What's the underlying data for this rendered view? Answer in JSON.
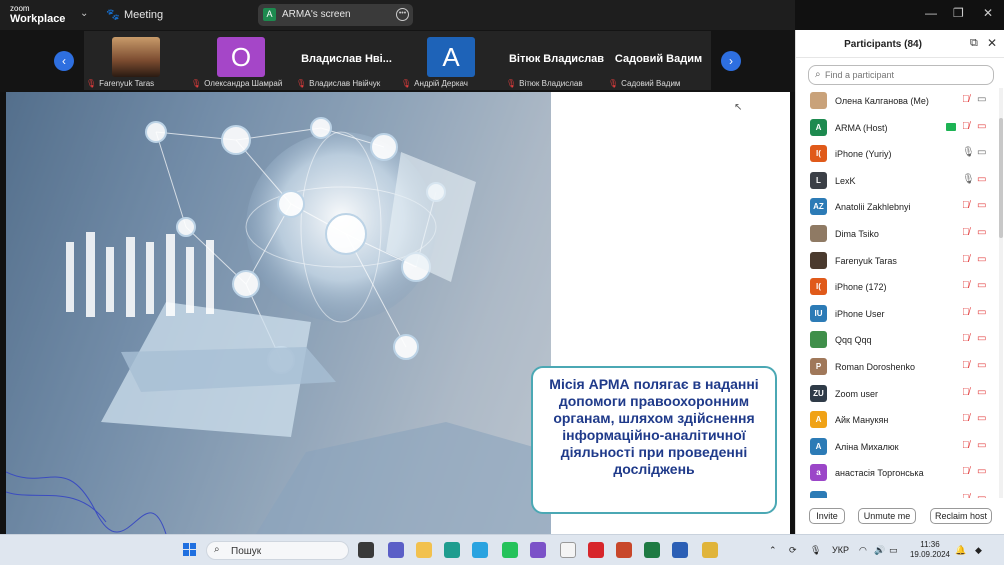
{
  "titlebar": {
    "brand_top": "zoom",
    "brand_bottom": "Workplace",
    "meeting_label": "Meeting",
    "screen_share_avatar": "A",
    "screen_share_label": "ARMA's screen"
  },
  "video_strip": {
    "tiles": [
      {
        "label": "Farenyuk Taras",
        "display": "",
        "kind": "photo"
      },
      {
        "label": "Олександра Шамрай",
        "display": "О",
        "kind": "avatar",
        "color": "#a546c8"
      },
      {
        "label": "Владислав Нвійчук",
        "display": "Владислав Нві...",
        "kind": "name"
      },
      {
        "label": "Андрій Деркач",
        "display": "A",
        "kind": "avatar",
        "color": "#1e63b8"
      },
      {
        "label": "Вітюк Владислав",
        "display": "Вітюк Владислав",
        "kind": "name"
      },
      {
        "label": "Садовий Вадим",
        "display": "Садовий Вадим",
        "kind": "name"
      }
    ]
  },
  "slide": {
    "caption": "Місія АРМА полягає в наданні допомоги правоохоронним органам, шляхом здійснення інформаційно-аналітичної діяльності при проведенні досліджень"
  },
  "participants": {
    "title": "Participants (84)",
    "search_placeholder": "Find a participant",
    "list": [
      {
        "name": "Олена Калганова (Me)",
        "avatar": "",
        "color": "#c9a27a",
        "mic": "muted",
        "video": "on-grey"
      },
      {
        "name": "ARMA (Host)",
        "avatar": "A",
        "color": "#1d8a4f",
        "mic": "muted",
        "video": "off",
        "sharing": true
      },
      {
        "name": "iPhone (Yuriy)",
        "avatar": "I(",
        "color": "#e05a1a",
        "mic": "on",
        "video": "on-grey"
      },
      {
        "name": "LexK",
        "avatar": "L",
        "color": "#3b3f46",
        "mic": "on",
        "video": "off"
      },
      {
        "name": "Anatolii Zakhlebnyi",
        "avatar": "AZ",
        "color": "#2c7bb6",
        "mic": "muted",
        "video": "off"
      },
      {
        "name": "Dima Tsiko",
        "avatar": "",
        "color": "#8f7a64",
        "mic": "muted",
        "video": "off"
      },
      {
        "name": "Farenyuk Taras",
        "avatar": "",
        "color": "#4a3a2e",
        "mic": "muted",
        "video": "off"
      },
      {
        "name": "iPhone (172)",
        "avatar": "I(",
        "color": "#e05a1a",
        "mic": "muted",
        "video": "off"
      },
      {
        "name": "iPhone User",
        "avatar": "IU",
        "color": "#2c7bb6",
        "mic": "muted",
        "video": "off"
      },
      {
        "name": "Qqq Qqq",
        "avatar": "",
        "color": "#3f8f4a",
        "mic": "muted",
        "video": "off"
      },
      {
        "name": "Roman Doroshenko",
        "avatar": "P",
        "color": "#a0785a",
        "mic": "muted",
        "video": "off"
      },
      {
        "name": "Zoom user",
        "avatar": "ZU",
        "color": "#2f3b48",
        "mic": "muted",
        "video": "off"
      },
      {
        "name": "Айк Манукян",
        "avatar": "A",
        "color": "#f0a216",
        "mic": "muted",
        "video": "off"
      },
      {
        "name": "Аліна Михалюк",
        "avatar": "A",
        "color": "#2c7bb6",
        "mic": "muted",
        "video": "off"
      },
      {
        "name": "анастасія Торгонська",
        "avatar": "a",
        "color": "#9b46c8",
        "mic": "muted",
        "video": "off"
      },
      {
        "name": "",
        "avatar": "",
        "color": "#2c7bb6",
        "mic": "muted",
        "video": "off"
      }
    ],
    "buttons": {
      "invite": "Invite",
      "unmute": "Unmute me",
      "reclaim": "Reclaim host"
    }
  },
  "taskbar": {
    "search_label": "Пошук",
    "language": "УКР",
    "time": "11:36",
    "date": "19.09.2024",
    "apps": [
      {
        "name": "task-view",
        "color": "#3a3a3a"
      },
      {
        "name": "teams",
        "color": "#5b5fc7"
      },
      {
        "name": "file-explorer",
        "color": "#f2c14e"
      },
      {
        "name": "edge",
        "color": "#1f9d8f"
      },
      {
        "name": "telegram",
        "color": "#2aa3e0"
      },
      {
        "name": "whatsapp",
        "color": "#25c25a"
      },
      {
        "name": "viber",
        "color": "#7b52c8"
      },
      {
        "name": "file",
        "color": "#f4f4f4"
      },
      {
        "name": "pdf-reader",
        "color": "#d7262b"
      },
      {
        "name": "powerpoint",
        "color": "#c8472a"
      },
      {
        "name": "excel",
        "color": "#1e7a43"
      },
      {
        "name": "word",
        "color": "#2b5fb5"
      },
      {
        "name": "chrome",
        "color": "#e0b43a"
      }
    ]
  }
}
